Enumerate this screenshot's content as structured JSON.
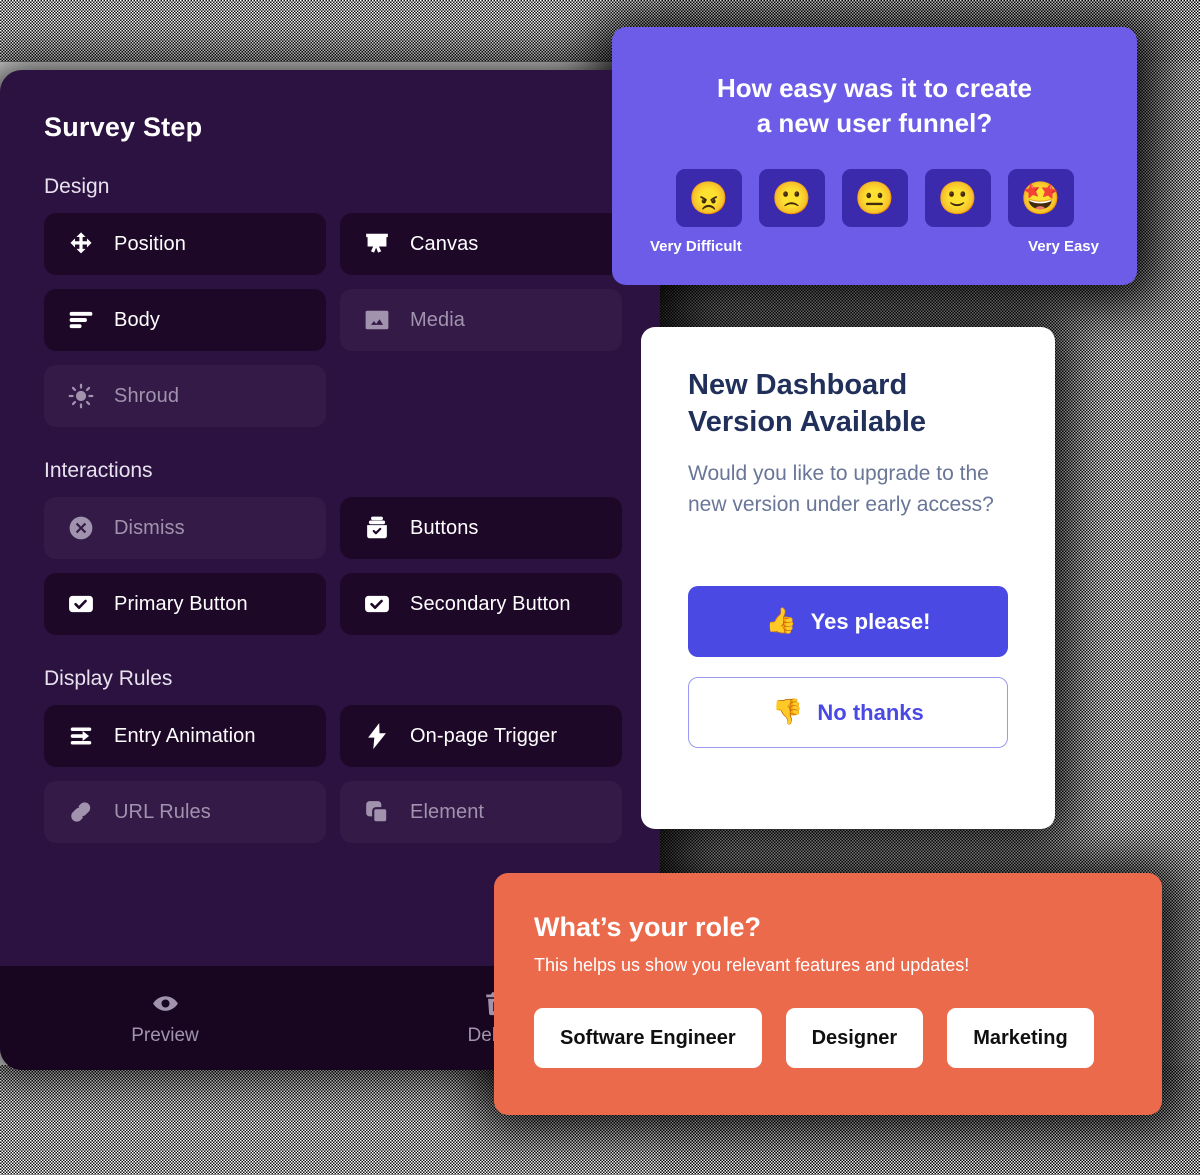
{
  "editor": {
    "title": "Survey Step",
    "sections": [
      {
        "name": "Design",
        "items": [
          {
            "label": "Position",
            "icon": "move-icon",
            "state": "active"
          },
          {
            "label": "Canvas",
            "icon": "canvas-icon",
            "state": "active"
          },
          {
            "label": "Body",
            "icon": "body-icon",
            "state": "active"
          },
          {
            "label": "Media",
            "icon": "media-icon",
            "state": "inactive"
          },
          {
            "label": "Shroud",
            "icon": "shroud-icon",
            "state": "inactive"
          }
        ]
      },
      {
        "name": "Interactions",
        "items": [
          {
            "label": "Dismiss",
            "icon": "dismiss-icon",
            "state": "inactive"
          },
          {
            "label": "Buttons",
            "icon": "buttons-icon",
            "state": "active"
          },
          {
            "label": "Primary Button",
            "icon": "checkbox-icon",
            "state": "active"
          },
          {
            "label": "Secondary Button",
            "icon": "checkbox-icon",
            "state": "active"
          }
        ]
      },
      {
        "name": "Display Rules",
        "items": [
          {
            "label": "Entry Animation",
            "icon": "entry-animation-icon",
            "state": "active"
          },
          {
            "label": "On-page Trigger",
            "icon": "bolt-icon",
            "state": "active"
          },
          {
            "label": "URL Rules",
            "icon": "link-icon",
            "state": "inactive"
          },
          {
            "label": "Element",
            "icon": "element-icon",
            "state": "inactive"
          }
        ]
      }
    ],
    "toolbar": [
      {
        "label": "Preview",
        "icon": "eye-icon"
      },
      {
        "label": "Delete",
        "icon": "trash-icon"
      }
    ]
  },
  "survey_card": {
    "question": "How easy was it to create a new user funnel?",
    "question_line1": "How easy was it to create",
    "question_line2": "a new user funnel?",
    "options": [
      {
        "emoji": "😠",
        "name": "angry-face"
      },
      {
        "emoji": "🙁",
        "name": "slightly-frowning-face"
      },
      {
        "emoji": "😐",
        "name": "neutral-face"
      },
      {
        "emoji": "🙂",
        "name": "slightly-smiling-face"
      },
      {
        "emoji": "🤩",
        "name": "star-struck-face"
      }
    ],
    "scale_low": "Very Difficult",
    "scale_high": "Very Easy",
    "bg_color": "#6c5ce7",
    "option_bg_color": "#3b2aab"
  },
  "dashboard_card": {
    "title_line1": "New Dashboard",
    "title_line2": "Version Available",
    "body": "Would you like to upgrade to the new version under early access?",
    "primary_button": {
      "label": "Yes please!",
      "emoji": "👍",
      "icon": "thumbs-up-icon"
    },
    "secondary_button": {
      "label": "No thanks",
      "emoji": "👎",
      "icon": "thumbs-down-icon"
    },
    "accent_color": "#4a49e4",
    "title_color": "#21305b"
  },
  "role_card": {
    "title": "What’s your role?",
    "subtitle": "This helps us show you relevant features and updates!",
    "options": [
      "Software Engineer",
      "Designer",
      "Marketing"
    ],
    "bg_color": "#ec6a4c"
  }
}
